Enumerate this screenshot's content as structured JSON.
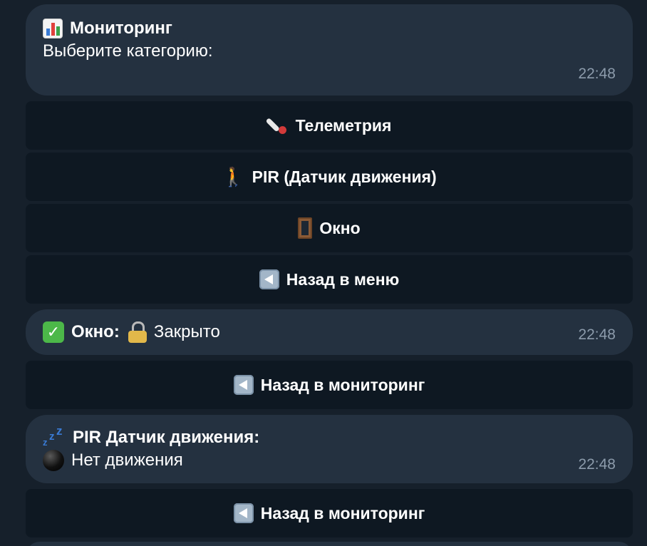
{
  "messages": [
    {
      "title_icon": "chart-icon",
      "title": "Мониторинг",
      "text": "Выберите категорию:",
      "time": "22:48"
    },
    {
      "icon": "check-icon",
      "label": "Окно:",
      "value_icon": "lock-icon",
      "value": "Закрыто",
      "time": "22:48"
    },
    {
      "icon": "zzz-icon",
      "title": "PIR Датчик движения:",
      "value_icon": "black-circle-icon",
      "value": "Нет движения",
      "time": "22:48"
    }
  ],
  "keyboard_monitoring": [
    {
      "icon": "thermometer-icon",
      "label": "Телеметрия"
    },
    {
      "icon": "person-walking-icon",
      "label": "PIR (Датчик движения)"
    },
    {
      "icon": "door-icon",
      "label": "Окно"
    },
    {
      "icon": "back-arrow-icon",
      "label": "Назад в меню"
    }
  ],
  "keyboard_window": {
    "icon": "back-arrow-icon",
    "label": "Назад в мониторинг"
  },
  "keyboard_pir": {
    "icon": "back-arrow-icon",
    "label": "Назад в мониторинг"
  },
  "colors": {
    "background": "#16202b",
    "bubble": "#243140",
    "button": "#0e1822",
    "time": "#8c9bab"
  }
}
